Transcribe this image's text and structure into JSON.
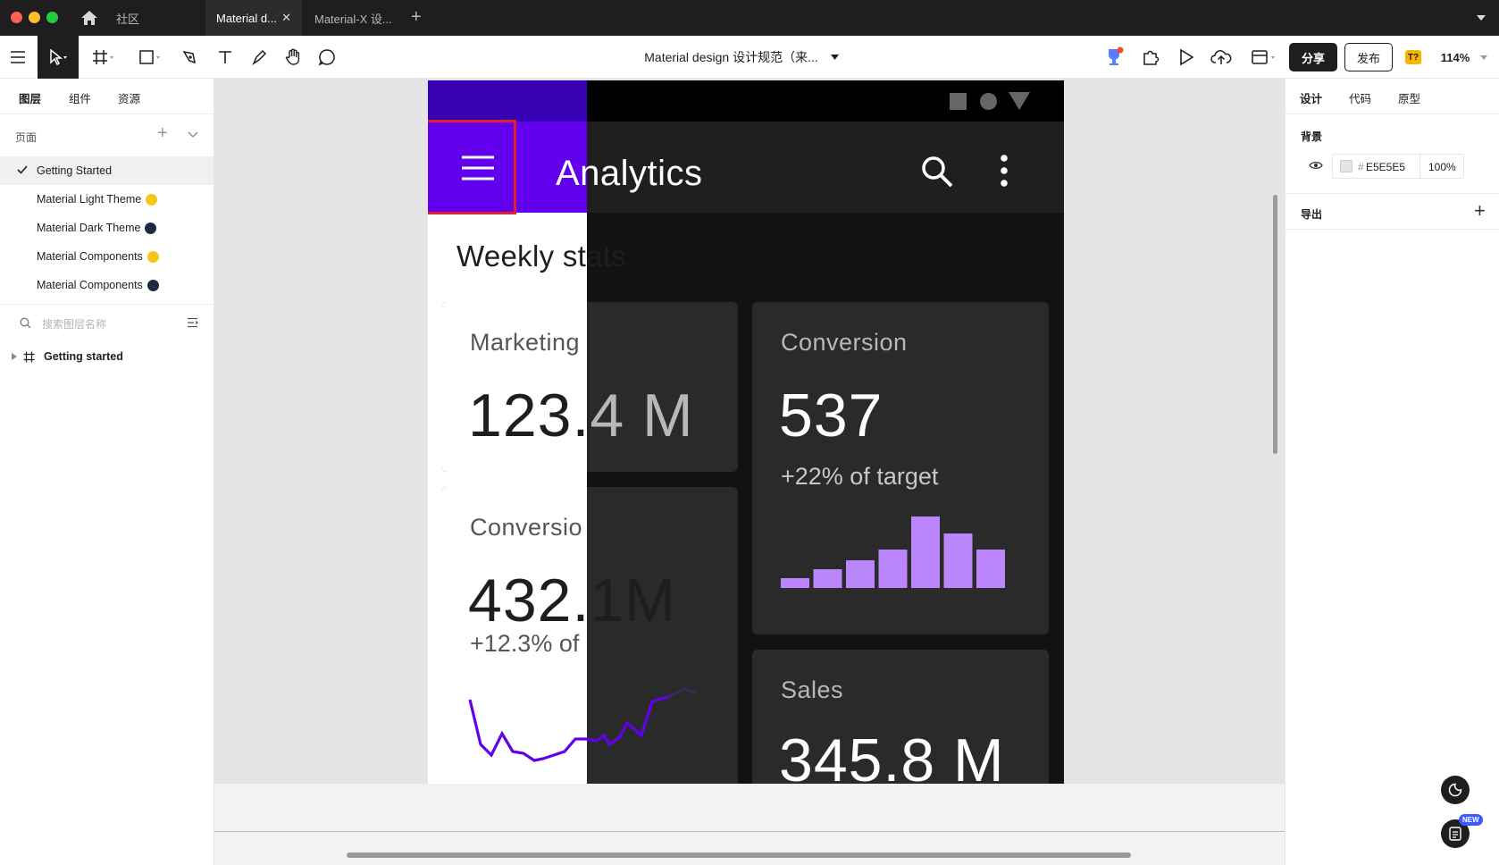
{
  "titlebar": {
    "home_tab": "社区",
    "tabs": [
      {
        "label": "Material d...",
        "active": true
      },
      {
        "label": "Material-X 设...",
        "active": false
      }
    ]
  },
  "toolbar": {
    "file_title": "Material design 设计规范（来...",
    "share_label": "分享",
    "publish_label": "发布",
    "badge": "T?",
    "zoom": "114%"
  },
  "left_panel": {
    "tabs": [
      "图层",
      "组件",
      "资源"
    ],
    "pages_header": "页面",
    "pages": [
      {
        "label": "Getting Started",
        "selected": true,
        "dot": ""
      },
      {
        "label": "Material Light Theme",
        "selected": false,
        "dot": "#f5c518"
      },
      {
        "label": "Material Dark Theme",
        "selected": false,
        "dot": "#1e2a44"
      },
      {
        "label": "Material Components",
        "selected": false,
        "dot": "#f5c518"
      },
      {
        "label": "Material Components",
        "selected": false,
        "dot": "#1e2a44"
      }
    ],
    "search_placeholder": "搜索图层名称",
    "layers": [
      {
        "label": "Getting started"
      }
    ]
  },
  "right_panel": {
    "tabs": [
      "设计",
      "代码",
      "原型"
    ],
    "background_label": "背景",
    "bg_hash": "#",
    "bg_color": "E5E5E5",
    "bg_opacity": "100%",
    "export_label": "导出"
  },
  "canvas": {
    "app_title": "Analytics",
    "section_title": "Weekly stats",
    "cards": {
      "marketing": {
        "label": "Marketing",
        "value": "123.4 M"
      },
      "conversion_top": {
        "label": "Conversion",
        "value": "537",
        "sub": "+22% of target"
      },
      "conversion_left": {
        "label": "Conversio",
        "value": "432.1M",
        "sub": "+12.3% of"
      },
      "sales": {
        "label": "Sales",
        "value": "345.8 M"
      }
    },
    "bar_values": [
      0.13,
      0.26,
      0.38,
      0.52,
      0.98,
      0.74,
      0.52
    ],
    "colors": {
      "primary": "#6200ee",
      "primary_dark": "#3700b3",
      "accent_bar": "#bb86fc",
      "highlight": "#e0202a"
    }
  },
  "floating": {
    "new_badge": "NEW"
  }
}
